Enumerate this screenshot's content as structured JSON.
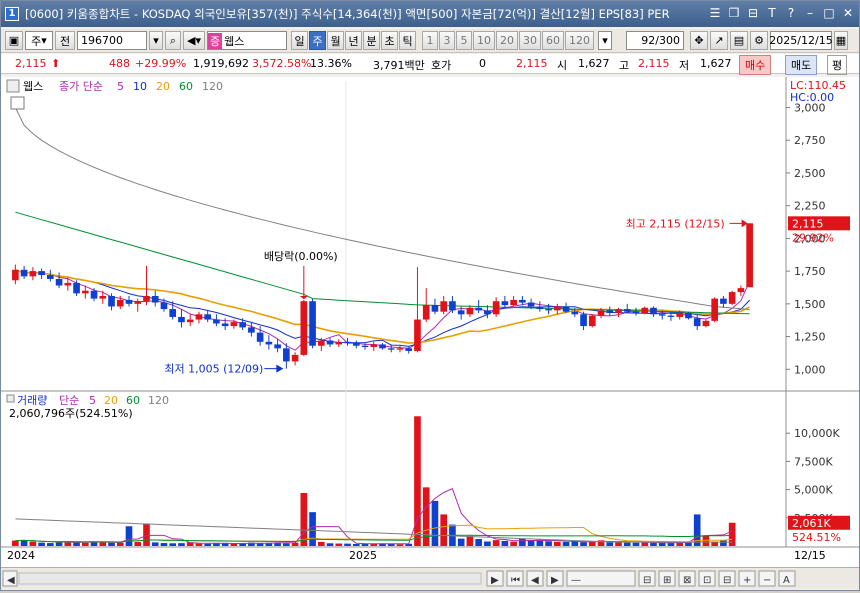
{
  "window": {
    "badge": "1",
    "title": "[0600] 키움종합차트 - KOSDAQ 외국인보유[357(천)] 주식수[14,364(천)] 액면[500] 자본금[72(억)] 결산[12월] EPS[83] PER"
  },
  "toolbar": {
    "mode_label": "주",
    "all_label": "전",
    "code": "196700",
    "stock_flag": "증",
    "stock_name": "웹스",
    "periods": [
      "일",
      "주",
      "월",
      "년",
      "분",
      "초",
      "틱"
    ],
    "active_period": "주",
    "intervals": [
      "1",
      "3",
      "5",
      "10",
      "20",
      "30",
      "60",
      "120"
    ],
    "count": "92/300",
    "date": "2025/12/15"
  },
  "quote": {
    "price": "2,115",
    "change": "488",
    "change_pct": "+29.99%",
    "volume": "1,919,692",
    "volume_pct": "3,572.58%",
    "turnover": "13.36%",
    "amount": "3,791백만",
    "hoga_label": "호가",
    "hoga_value": "0",
    "price2": "2,115",
    "open_label": "시",
    "open": "1,627",
    "high_label": "고",
    "high": "2,115",
    "low_label": "저",
    "low": "1,627",
    "buy": "매수",
    "sell": "매도",
    "eval": "평"
  },
  "price_pane": {
    "stock_tag": "웹스",
    "ma_title": "종가 단순",
    "ma_periods": [
      "5",
      "10",
      "20",
      "60",
      "120"
    ],
    "ma_colors": [
      "#b02ab0",
      "#1030d0",
      "#e8a000",
      "#009030",
      "#808080"
    ],
    "lc_label": "LC:110.45",
    "hc_label": "HC:0.00",
    "yticks": [
      "3,000",
      "2,750",
      "2,500",
      "2,250",
      "2,000",
      "1,750",
      "1,500",
      "1,250",
      "1,000"
    ],
    "dividend_note": "배당락(0.00%)",
    "max_note": "최고 2,115 (12/15)",
    "min_note": "최저 1,005 (12/09)",
    "last_price_tag": "2,115",
    "last_pct_tag": "29.92%"
  },
  "volume_pane": {
    "title": "거래량",
    "ma_title": "단순",
    "ma_periods": [
      "5",
      "20",
      "60",
      "120"
    ],
    "info": "2,060,796주(524.51%)",
    "yticks": [
      "10,000K",
      "7,500K",
      "5,000K",
      "2,500K"
    ],
    "last_tag": "2,061K",
    "last_pct": "524.51%"
  },
  "xaxis": {
    "labels": [
      "2024",
      "2025"
    ],
    "right_label": "12/15"
  },
  "colors": {
    "up": "#e0131a",
    "down": "#1040d0",
    "titlebar": "#4a6c98"
  },
  "chart_data": {
    "type": "candlestick",
    "period": "weekly",
    "candles_ohlc": [
      [
        1680,
        1800,
        1650,
        1760
      ],
      [
        1760,
        1790,
        1690,
        1710
      ],
      [
        1710,
        1780,
        1680,
        1750
      ],
      [
        1750,
        1770,
        1690,
        1720
      ],
      [
        1720,
        1760,
        1670,
        1690
      ],
      [
        1690,
        1740,
        1620,
        1640
      ],
      [
        1640,
        1700,
        1600,
        1660
      ],
      [
        1660,
        1680,
        1560,
        1580
      ],
      [
        1580,
        1640,
        1540,
        1600
      ],
      [
        1600,
        1620,
        1520,
        1540
      ],
      [
        1540,
        1600,
        1500,
        1560
      ],
      [
        1560,
        1580,
        1450,
        1480
      ],
      [
        1480,
        1560,
        1460,
        1530
      ],
      [
        1530,
        1560,
        1480,
        1500
      ],
      [
        1500,
        1540,
        1440,
        1520
      ],
      [
        1520,
        1790,
        1490,
        1560
      ],
      [
        1560,
        1600,
        1480,
        1510
      ],
      [
        1510,
        1540,
        1440,
        1460
      ],
      [
        1460,
        1520,
        1380,
        1400
      ],
      [
        1400,
        1460,
        1320,
        1360
      ],
      [
        1360,
        1420,
        1330,
        1380
      ],
      [
        1380,
        1440,
        1350,
        1420
      ],
      [
        1420,
        1450,
        1360,
        1380
      ],
      [
        1380,
        1420,
        1330,
        1350
      ],
      [
        1350,
        1390,
        1300,
        1330
      ],
      [
        1330,
        1380,
        1310,
        1360
      ],
      [
        1360,
        1390,
        1300,
        1320
      ],
      [
        1320,
        1360,
        1250,
        1280
      ],
      [
        1280,
        1330,
        1180,
        1210
      ],
      [
        1210,
        1260,
        1150,
        1190
      ],
      [
        1190,
        1230,
        1130,
        1160
      ],
      [
        1160,
        1200,
        1005,
        1060
      ],
      [
        1060,
        1130,
        1030,
        1110
      ],
      [
        1110,
        1530,
        1100,
        1520
      ],
      [
        1520,
        1540,
        1160,
        1180
      ],
      [
        1180,
        1240,
        1140,
        1220
      ],
      [
        1220,
        1240,
        1170,
        1190
      ],
      [
        1190,
        1230,
        1170,
        1210
      ],
      [
        1210,
        1240,
        1180,
        1200
      ],
      [
        1200,
        1220,
        1160,
        1180
      ],
      [
        1180,
        1200,
        1150,
        1170
      ],
      [
        1170,
        1210,
        1140,
        1190
      ],
      [
        1190,
        1200,
        1150,
        1160
      ],
      [
        1160,
        1190,
        1130,
        1150
      ],
      [
        1150,
        1180,
        1130,
        1160
      ],
      [
        1160,
        1170,
        1120,
        1140
      ],
      [
        1140,
        1780,
        1130,
        1380
      ],
      [
        1380,
        1620,
        1360,
        1490
      ],
      [
        1490,
        1540,
        1420,
        1440
      ],
      [
        1440,
        1560,
        1420,
        1520
      ],
      [
        1520,
        1560,
        1430,
        1450
      ],
      [
        1450,
        1480,
        1380,
        1420
      ],
      [
        1420,
        1490,
        1400,
        1470
      ],
      [
        1470,
        1530,
        1430,
        1450
      ],
      [
        1450,
        1490,
        1390,
        1420
      ],
      [
        1420,
        1550,
        1400,
        1520
      ],
      [
        1520,
        1560,
        1470,
        1490
      ],
      [
        1490,
        1560,
        1480,
        1530
      ],
      [
        1530,
        1560,
        1490,
        1510
      ],
      [
        1510,
        1540,
        1460,
        1480
      ],
      [
        1480,
        1520,
        1440,
        1460
      ],
      [
        1460,
        1500,
        1420,
        1450
      ],
      [
        1450,
        1500,
        1420,
        1480
      ],
      [
        1480,
        1510,
        1430,
        1440
      ],
      [
        1440,
        1470,
        1400,
        1420
      ],
      [
        1420,
        1440,
        1300,
        1330
      ],
      [
        1330,
        1420,
        1320,
        1410
      ],
      [
        1410,
        1470,
        1390,
        1450
      ],
      [
        1450,
        1480,
        1410,
        1430
      ],
      [
        1430,
        1470,
        1400,
        1460
      ],
      [
        1460,
        1500,
        1430,
        1440
      ],
      [
        1440,
        1470,
        1410,
        1430
      ],
      [
        1430,
        1480,
        1420,
        1470
      ],
      [
        1470,
        1480,
        1400,
        1420
      ],
      [
        1420,
        1450,
        1380,
        1410
      ],
      [
        1410,
        1440,
        1370,
        1400
      ],
      [
        1400,
        1450,
        1380,
        1430
      ],
      [
        1430,
        1440,
        1380,
        1390
      ],
      [
        1390,
        1420,
        1300,
        1330
      ],
      [
        1330,
        1380,
        1320,
        1370
      ],
      [
        1370,
        1550,
        1360,
        1540
      ],
      [
        1540,
        1560,
        1470,
        1500
      ],
      [
        1500,
        1600,
        1490,
        1590
      ],
      [
        1590,
        1640,
        1560,
        1620
      ],
      [
        1627,
        2115,
        1627,
        2115
      ]
    ],
    "volumes_k": [
      480,
      520,
      380,
      300,
      260,
      340,
      420,
      310,
      280,
      390,
      350,
      290,
      300,
      1750,
      350,
      2000,
      320,
      260,
      240,
      250,
      330,
      210,
      200,
      260,
      230,
      190,
      210,
      300,
      260,
      280,
      320,
      240,
      300,
      4700,
      3000,
      360,
      240,
      220,
      210,
      180,
      200,
      190,
      230,
      180,
      160,
      200,
      11500,
      5200,
      4000,
      2800,
      1900,
      650,
      900,
      620,
      400,
      520,
      450,
      380,
      640,
      450,
      560,
      420,
      380,
      360,
      400,
      340,
      420,
      500,
      330,
      380,
      300,
      290,
      320,
      270,
      280,
      260,
      380,
      300,
      2800,
      900,
      400,
      520,
      2061
    ],
    "ylim": [
      880,
      3080
    ],
    "vol_ylim": [
      0,
      12500
    ]
  }
}
